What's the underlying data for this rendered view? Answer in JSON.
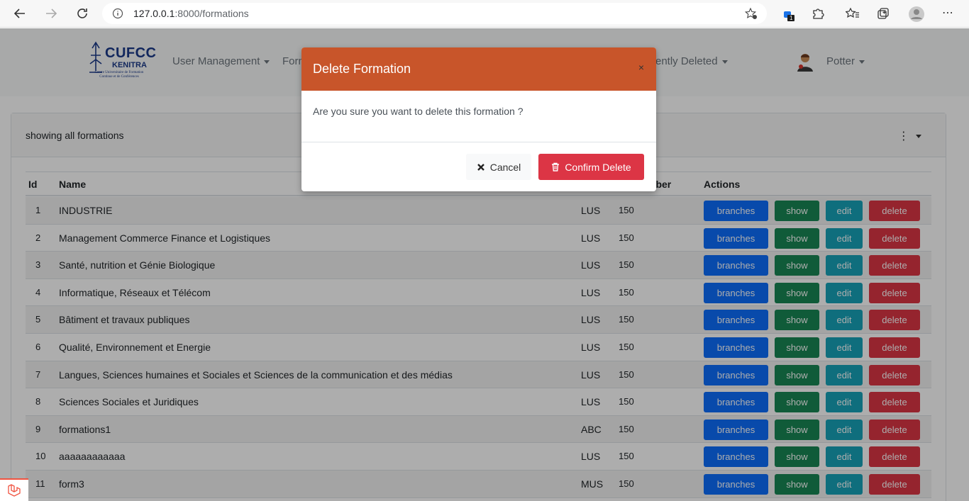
{
  "browser": {
    "url_host": "127.0.0.1",
    "url_rest": ":8000/formations",
    "extension_badge": "1"
  },
  "nav": {
    "logo_title": "CUFCC",
    "logo_sub": "KENITRA",
    "logo_tag": "Centre Universitaire de Formation Continue et de Conférences",
    "items": [
      {
        "label": "User Management"
      },
      {
        "label": "Form"
      },
      {
        "label": "ently Deleted"
      }
    ],
    "user": "Potter"
  },
  "card": {
    "title": "showing all formations"
  },
  "table": {
    "headers": {
      "id": "Id",
      "name": "Name",
      "number": "mber",
      "actions": "Actions"
    },
    "rows": [
      {
        "id": "1",
        "name": "INDUSTRIE",
        "type": "LUS",
        "number": "150"
      },
      {
        "id": "2",
        "name": "Management Commerce Finance et Logistiques",
        "type": "LUS",
        "number": "150"
      },
      {
        "id": "3",
        "name": "Santé, nutrition et Génie Biologique",
        "type": "LUS",
        "number": "150"
      },
      {
        "id": "4",
        "name": "Informatique, Réseaux et Télécom",
        "type": "LUS",
        "number": "150"
      },
      {
        "id": "5",
        "name": "Bâtiment et travaux publiques",
        "type": "LUS",
        "number": "150"
      },
      {
        "id": "6",
        "name": "Qualité, Environnement et Energie",
        "type": "LUS",
        "number": "150"
      },
      {
        "id": "7",
        "name": "Langues, Sciences humaines et Sociales et Sciences de la communication et des médias",
        "type": "LUS",
        "number": "150"
      },
      {
        "id": "8",
        "name": "Sciences Sociales et Juridiques",
        "type": "LUS",
        "number": "150"
      },
      {
        "id": "9",
        "name": "formations1",
        "type": "ABC",
        "number": "150"
      },
      {
        "id": "10",
        "name": "aaaaaaaaaaaa",
        "type": "LUS",
        "number": "150"
      },
      {
        "id": "11",
        "name": "form3",
        "type": "MUS",
        "number": "150"
      }
    ],
    "actions": {
      "branches": "branches",
      "show": "show",
      "edit": "edit",
      "delete": "delete"
    }
  },
  "modal": {
    "title": "Delete Formation",
    "close": "×",
    "message": "Are you sure you want to delete this formation ?",
    "cancel_label": "Cancel",
    "confirm_label": "Confirm Delete"
  },
  "colors": {
    "modal_header": "#c8552a",
    "primary": "#0d6efd",
    "success": "#198754",
    "info": "#17a2b8",
    "danger": "#dc3545"
  },
  "icons": [
    "back-icon",
    "forward-icon",
    "reload-icon",
    "info-icon",
    "favorite-add-icon",
    "extension-icon",
    "puzzle-icon",
    "favorites-icon",
    "collections-icon",
    "profile-icon",
    "more-icon",
    "kebab-icon",
    "times-icon",
    "trash-icon",
    "laravel-icon"
  ]
}
